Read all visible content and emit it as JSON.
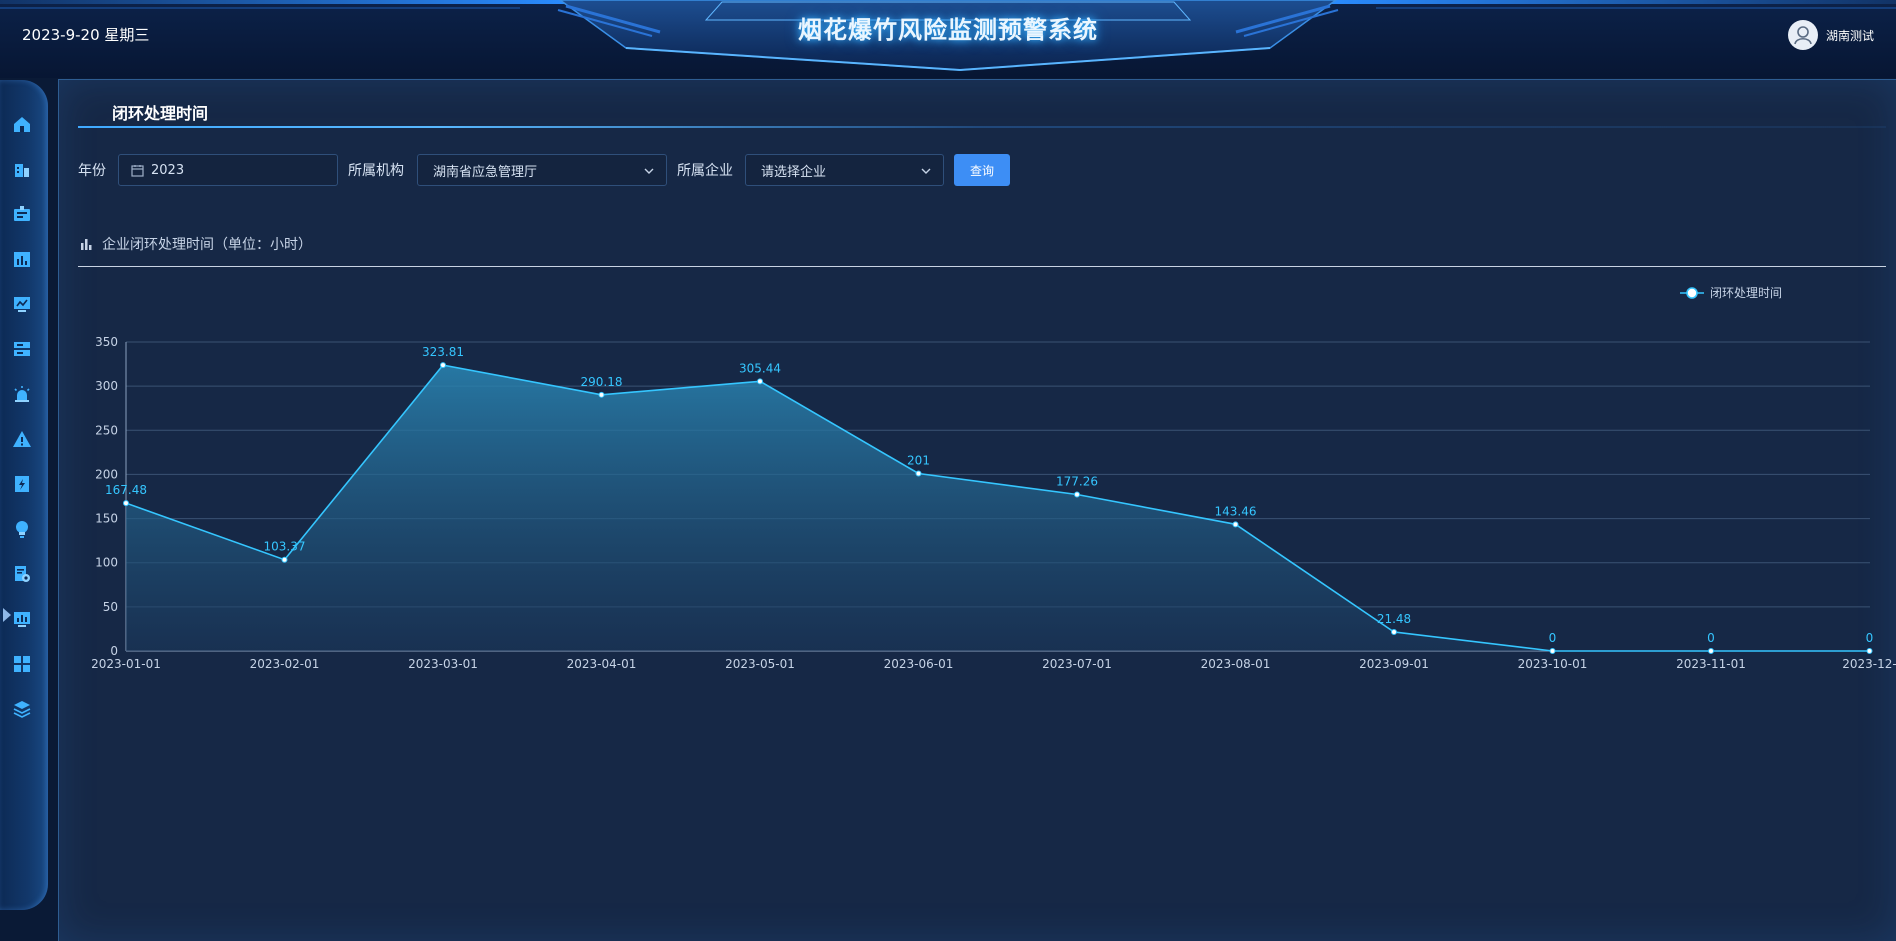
{
  "header": {
    "date": "2023-9-20 星期三",
    "title": "烟花爆竹风险监测预警系统",
    "user": "湖南测试"
  },
  "sidebar": {
    "icons": [
      "home-icon",
      "building-icon",
      "id-card-icon",
      "bar-chart-icon",
      "monitor-icon",
      "server-icon",
      "alarm-icon",
      "warning-icon",
      "report-icon",
      "bulb-icon",
      "doc-settings-icon",
      "dashboard-icon",
      "grid-icon",
      "layers-icon"
    ],
    "active_index": 11
  },
  "panel": {
    "title": "闭环处理时间"
  },
  "filters": {
    "year_label": "年份",
    "year_value": "2023",
    "org_label": "所属机构",
    "org_value": "湖南省应急管理厅",
    "company_label": "所属企业",
    "company_placeholder": "请选择企业",
    "query_label": "查询"
  },
  "chart_header": "企业闭环处理时间（单位：小时）",
  "colors": {
    "line": "#35c6ff",
    "accent": "#3d8ef5"
  },
  "chart_data": {
    "type": "area",
    "title": "企业闭环处理时间（单位：小时）",
    "x": [
      "2023-01-01",
      "2023-02-01",
      "2023-03-01",
      "2023-04-01",
      "2023-05-01",
      "2023-06-01",
      "2023-07-01",
      "2023-08-01",
      "2023-09-01",
      "2023-10-01",
      "2023-11-01",
      "2023-12-"
    ],
    "series": [
      {
        "name": "闭环处理时间",
        "values": [
          167.48,
          103.37,
          323.81,
          290.18,
          305.44,
          201,
          177.26,
          143.46,
          21.48,
          0,
          0,
          0
        ]
      }
    ],
    "data_labels": [
      "167.48",
      "103.37",
      "323.81",
      "290.18",
      "305.44",
      "201",
      "177.26",
      "143.46",
      "21.48",
      "0",
      "0",
      "0"
    ],
    "yticks": [
      "0",
      "50",
      "100",
      "150",
      "200",
      "250",
      "300",
      "350"
    ],
    "ylim": [
      0,
      350
    ],
    "grid": true,
    "legend": "top-right"
  }
}
